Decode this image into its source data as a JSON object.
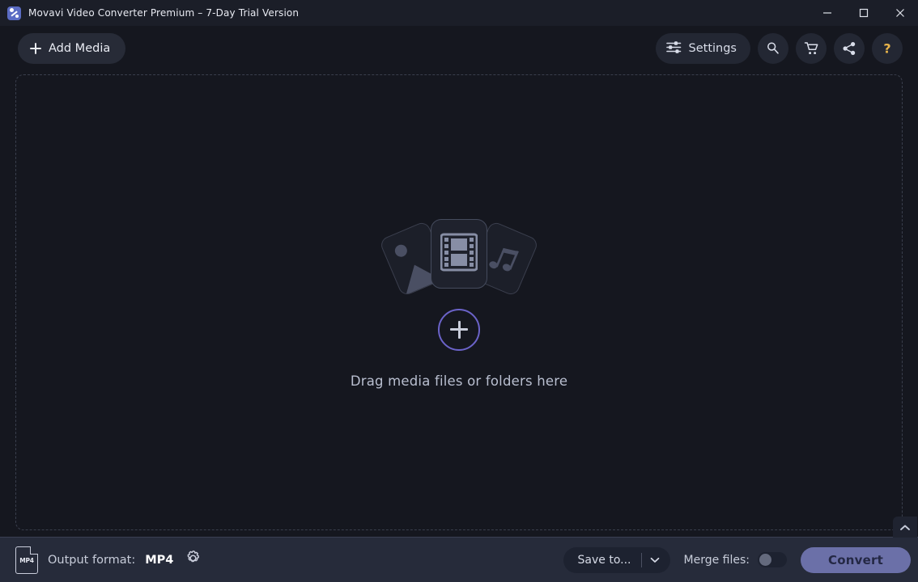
{
  "titlebar": {
    "title": "Movavi Video Converter Premium – 7-Day Trial Version",
    "app_icon": "movavi-logo-icon",
    "minimize_icon": "minimize-icon",
    "maximize_icon": "maximize-icon",
    "close_icon": "close-icon"
  },
  "toolbar": {
    "add_media_label": "Add Media",
    "add_media_icon": "plus-icon",
    "settings_label": "Settings",
    "settings_icon": "sliders-icon",
    "search_icon": "search-icon",
    "cart_icon": "shopping-cart-icon",
    "share_icon": "share-icon",
    "help_icon": "question-mark-icon"
  },
  "dropzone": {
    "label": "Drag media files or folders here",
    "add_icon": "plus-circle-icon",
    "photo_card_icon": "image-card-icon",
    "video_card_icon": "film-strip-card-icon",
    "audio_card_icon": "music-note-card-icon",
    "collapse_icon": "chevron-up-icon"
  },
  "bottombar": {
    "file_icon_label": "MP4",
    "output_format_label": "Output format:",
    "output_format_value": "MP4",
    "format_settings_icon": "gear-icon",
    "save_to_label": "Save to...",
    "save_to_chevron_icon": "chevron-down-icon",
    "merge_files_label": "Merge files:",
    "merge_files_state": "off",
    "convert_label": "Convert"
  },
  "colors": {
    "window_bg": "#15171f",
    "titlebar_bg": "#1b1e28",
    "bottombar_bg": "#262b3a",
    "accent_purple": "#6b63c9",
    "convert_button": "#6b70a8",
    "help_gold": "#e8b44a",
    "brand_blue": "#5b6cc4"
  }
}
